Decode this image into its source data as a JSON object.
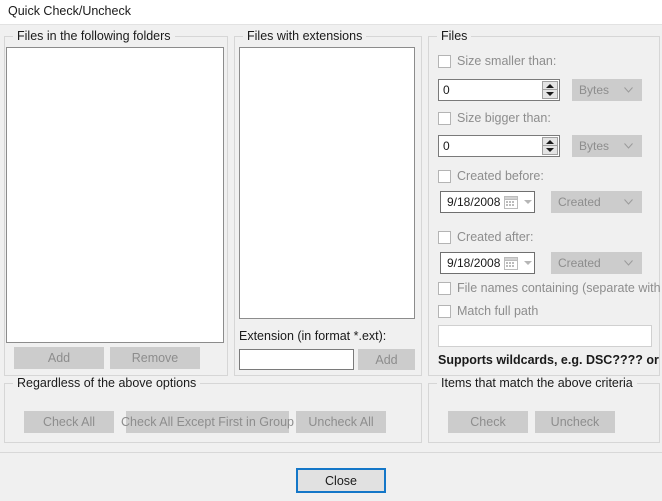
{
  "window": {
    "title": "Quick Check/Uncheck"
  },
  "folders_group": {
    "label": "Files in the following folders",
    "listbox_value": "",
    "add_button": "Add",
    "remove_button": "Remove"
  },
  "extensions_group": {
    "label": "Files with extensions",
    "listbox_value": "",
    "extension_label": "Extension (in format *.ext):",
    "extension_input_value": "",
    "extension_input_placeholder": "",
    "add_button": "Add"
  },
  "files_group": {
    "label": "Files",
    "size_smaller": {
      "checkbox_label": "Size smaller than:",
      "checked": false,
      "value": "0",
      "unit": "Bytes"
    },
    "size_bigger": {
      "checkbox_label": "Size bigger than:",
      "checked": false,
      "value": "0",
      "unit": "Bytes"
    },
    "created_before": {
      "checkbox_label": "Created before:",
      "checked": false,
      "date": "9/18/2008",
      "date_type": "Created"
    },
    "created_after": {
      "checkbox_label": "Created after:",
      "checked": false,
      "date": "9/18/2008",
      "date_type": "Created"
    },
    "file_names_containing": {
      "checkbox_label": "File names containing (separate with | )",
      "checked": false
    },
    "match_full_path": {
      "checkbox_label": "Match full path",
      "checked": false
    },
    "names_input_value": "",
    "names_input_placeholder": "",
    "wildcard_hint": "Supports wildcards, e.g. DSC???? or DSC*"
  },
  "regardless_group": {
    "label": "Regardless of the above options",
    "check_all_button": "Check All",
    "check_all_except_first_button": "Check All Except First in Group",
    "uncheck_all_button": "Uncheck All"
  },
  "matching_group": {
    "label": "Items that match the above criteria",
    "check_button": "Check",
    "uncheck_button": "Uncheck"
  },
  "footer": {
    "close_button": "Close"
  },
  "colors": {
    "focus_border": "#1477c8",
    "dialog_background": "#f0f0f0",
    "disabled_text": "#8d8d8d"
  }
}
